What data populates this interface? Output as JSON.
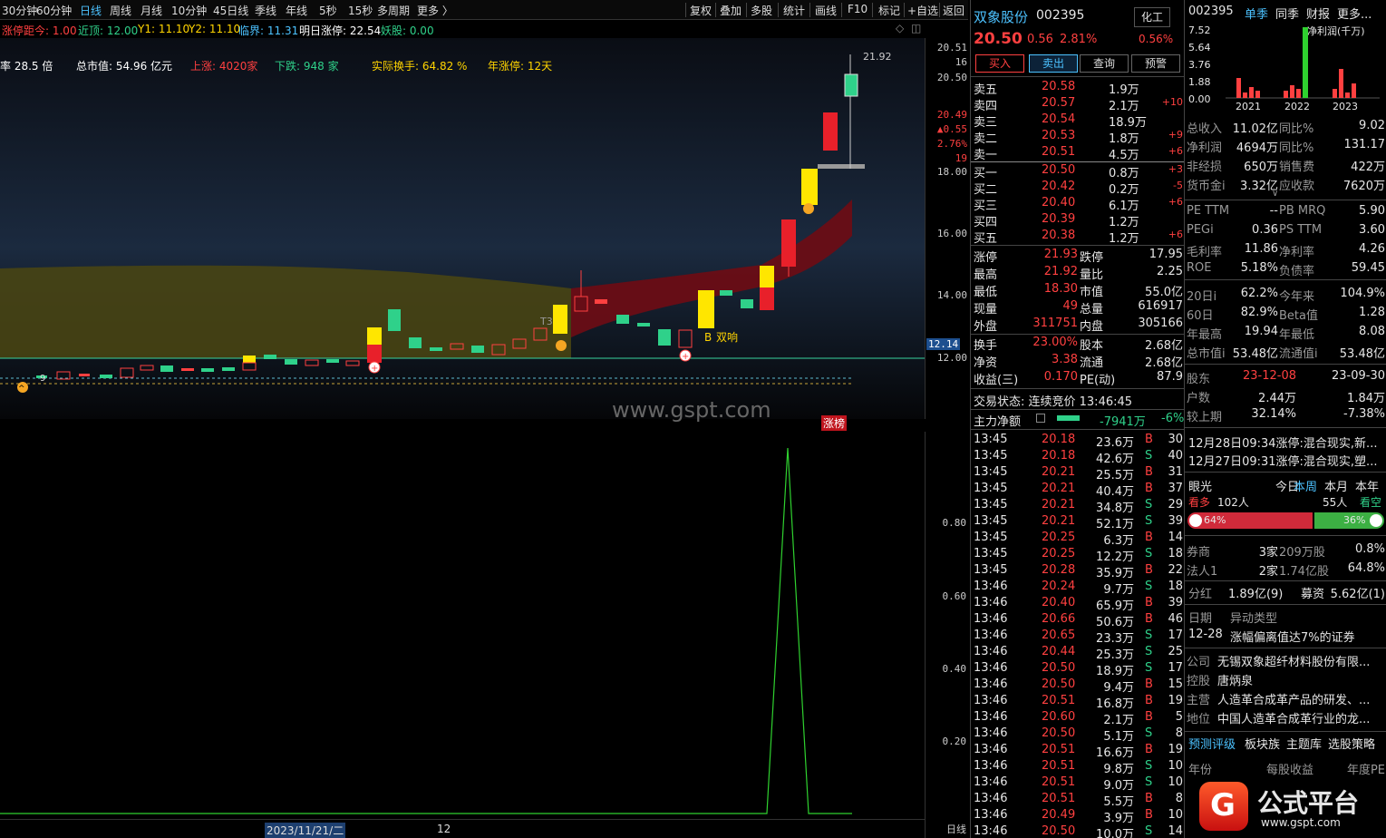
{
  "toolbar": {
    "items": [
      "30分钟",
      "60分钟",
      "日线",
      "周线",
      "月线",
      "10分钟",
      "45日线",
      "季线",
      "年线",
      "5秒",
      "15秒",
      "多周期",
      "更多 〉"
    ],
    "right": [
      "复权",
      "叠加",
      "多股",
      "统计",
      "画线",
      "F10",
      "标记",
      "+自选",
      "返回"
    ]
  },
  "info1": {
    "a": "涨停距今: 1.00",
    "b": "近顶: 12.00",
    "c": "Y1: 11.10",
    "d": "Y2: 11.10",
    "e": "临界: 11.31",
    "f": "明日涨停: 22.54",
    "g": "妖股: 0.00"
  },
  "info2": {
    "a": "率  28.5 倍",
    "b": "总市值: 54.96 亿元",
    "c": "上涨: 4020家",
    "d": "下跌: 948 家",
    "e": "实际换手: 64.82 %",
    "f": "年涨停: 12天"
  },
  "chart": {
    "yticks": [
      "20.51",
      "16",
      "20.50",
      "18.00",
      "16.00",
      "14.00",
      "12.00"
    ],
    "pct": [
      "20.49",
      "▲0.55",
      "2.76%",
      "19"
    ],
    "high_label": "21.92",
    "last_price_tag": "12.14",
    "tag_t3": "T3",
    "tag_shuangxiang": "双响",
    "tag_b": "B",
    "tag_9": "9",
    "watermark": "www.gspt.com",
    "zhangbang": "涨榜"
  },
  "lower": {
    "yticks": [
      "0.80",
      "0.60",
      "0.40",
      "0.20"
    ],
    "period": "日线"
  },
  "bottom": {
    "date": "2023/11/21/二",
    "month": "12"
  },
  "stock": {
    "name": "双象股份",
    "code": "002395",
    "sector": "化工",
    "price": "20.50",
    "change": "0.56",
    "pct": "2.81%",
    "extra": "0.56%",
    "buttons": [
      "买入",
      "卖出",
      "查询",
      "预警"
    ]
  },
  "asks": [
    {
      "label": "卖五",
      "price": "20.58",
      "vol": "1.9万",
      "chg": ""
    },
    {
      "label": "卖四",
      "price": "20.57",
      "vol": "2.1万",
      "chg": "+10"
    },
    {
      "label": "卖三",
      "price": "20.54",
      "vol": "18.9万",
      "chg": ""
    },
    {
      "label": "卖二",
      "price": "20.53",
      "vol": "1.8万",
      "chg": "+9"
    },
    {
      "label": "卖一",
      "price": "20.51",
      "vol": "4.5万",
      "chg": "+6"
    }
  ],
  "bids": [
    {
      "label": "买一",
      "price": "20.50",
      "vol": "0.8万",
      "chg": "+3"
    },
    {
      "label": "买二",
      "price": "20.42",
      "vol": "0.2万",
      "chg": "-5"
    },
    {
      "label": "买三",
      "price": "20.40",
      "vol": "6.1万",
      "chg": "+6"
    },
    {
      "label": "买四",
      "price": "20.39",
      "vol": "1.2万",
      "chg": ""
    },
    {
      "label": "买五",
      "price": "20.38",
      "vol": "1.2万",
      "chg": "+6"
    }
  ],
  "stats": [
    {
      "l1": "涨停",
      "v1": "21.93",
      "l2": "跌停",
      "v2": "17.95"
    },
    {
      "l1": "最高",
      "v1": "21.92",
      "l2": "量比",
      "v2": "2.25"
    },
    {
      "l1": "最低",
      "v1": "18.30",
      "l2": "市值",
      "v2": "55.0亿"
    },
    {
      "l1": "现量",
      "v1": "49",
      "l2": "总量",
      "v2": "616917"
    },
    {
      "l1": "外盘",
      "v1": "311751",
      "l2": "内盘",
      "v2": "305166"
    }
  ],
  "stats2": [
    {
      "l1": "换手",
      "v1": "23.00%",
      "l2": "股本",
      "v2": "2.68亿"
    },
    {
      "l1": "净资",
      "v1": "3.38",
      "l2": "流通",
      "v2": "2.68亿"
    },
    {
      "l1": "收益(三)",
      "v1": "0.170",
      "l2": "PE(动)",
      "v2": "87.9"
    }
  ],
  "trade_state": "交易状态: 连续竞价 13:46:45",
  "main_flow": {
    "label": "主力净额",
    "value": "-7941万",
    "pct": "-6%"
  },
  "ticks": [
    [
      "13:45",
      "20.18",
      "23.6万",
      "B",
      "30"
    ],
    [
      "13:45",
      "20.18",
      "42.6万",
      "S",
      "40"
    ],
    [
      "13:45",
      "20.21",
      "25.5万",
      "B",
      "31"
    ],
    [
      "13:45",
      "20.21",
      "40.4万",
      "B",
      "37"
    ],
    [
      "13:45",
      "20.21",
      "34.8万",
      "S",
      "29"
    ],
    [
      "13:45",
      "20.21",
      "52.1万",
      "S",
      "39"
    ],
    [
      "13:45",
      "20.25",
      "6.3万",
      "B",
      "14"
    ],
    [
      "13:45",
      "20.25",
      "12.2万",
      "S",
      "18"
    ],
    [
      "13:45",
      "20.28",
      "35.9万",
      "B",
      "22"
    ],
    [
      "13:46",
      "20.24",
      "9.7万",
      "S",
      "18"
    ],
    [
      "13:46",
      "20.40",
      "65.9万",
      "B",
      "39"
    ],
    [
      "13:46",
      "20.66",
      "50.6万",
      "B",
      "46"
    ],
    [
      "13:46",
      "20.65",
      "23.3万",
      "S",
      "17"
    ],
    [
      "13:46",
      "20.44",
      "25.3万",
      "S",
      "25"
    ],
    [
      "13:46",
      "20.50",
      "18.9万",
      "S",
      "17"
    ],
    [
      "13:46",
      "20.50",
      "9.4万",
      "B",
      "15"
    ],
    [
      "13:46",
      "20.51",
      "16.8万",
      "B",
      "19"
    ],
    [
      "13:46",
      "20.60",
      "2.1万",
      "B",
      "5"
    ],
    [
      "13:46",
      "20.50",
      "5.1万",
      "S",
      "8"
    ],
    [
      "13:46",
      "20.51",
      "16.6万",
      "B",
      "19"
    ],
    [
      "13:46",
      "20.51",
      "9.8万",
      "S",
      "10"
    ],
    [
      "13:46",
      "20.51",
      "9.0万",
      "S",
      "10"
    ],
    [
      "13:46",
      "20.51",
      "5.5万",
      "B",
      "8"
    ],
    [
      "13:46",
      "20.49",
      "3.9万",
      "B",
      "10"
    ],
    [
      "13:46",
      "20.50",
      "10.0万",
      "S",
      "14"
    ]
  ],
  "right": {
    "code": "002395",
    "tabs": [
      "单季",
      "同季",
      "财报",
      "更多..."
    ],
    "mini_y": [
      "7.52",
      "5.64",
      "3.76",
      "1.88",
      "0.00"
    ],
    "mini_title": "净利润(千万)",
    "mini_x": [
      "2021",
      "2022",
      "2023"
    ],
    "fin": [
      [
        "总收入",
        "11.02亿",
        "同比%",
        "9.02"
      ],
      [
        "净利润",
        "4694万",
        "同比%",
        "131.17"
      ],
      [
        "非经损",
        "650万",
        "销售费",
        "422万"
      ],
      [
        "货币金i",
        "3.32亿",
        "应收款",
        "7620万"
      ]
    ],
    "val": [
      [
        "PE TTM",
        "--",
        "PB MRQ",
        "5.90"
      ],
      [
        "PEGi",
        "0.36",
        "PS TTM",
        "3.60"
      ],
      [
        "毛利率",
        "11.86",
        "净利率",
        "4.26"
      ],
      [
        "ROE",
        "5.18%",
        "负债率",
        "59.45"
      ]
    ],
    "perf": [
      [
        "20日i",
        "62.2%",
        "今年来",
        "104.9%"
      ],
      [
        "60日",
        "82.9%",
        "Beta值",
        "1.28"
      ],
      [
        "年最高",
        "19.94",
        "年最低",
        "8.08"
      ],
      [
        "总市值i",
        "53.48亿",
        "流通值i",
        "53.48亿"
      ]
    ],
    "holders": [
      [
        "股东",
        "23-12-08",
        "23-09-30"
      ],
      [
        "户数",
        "2.44万",
        "1.84万"
      ],
      [
        "较上期",
        "32.14%",
        "-7.38%"
      ]
    ],
    "news": [
      "12月28日09:34涨停:混合现实,新...",
      "12月27日09:31涨停:混合现实,塑..."
    ],
    "vision": {
      "label": "眼光",
      "t1": "今日",
      "t2": "本周",
      "t3": "本月",
      "t4": "本年",
      "bull": "看多",
      "bull_n": "102人",
      "bear_n": "55人",
      "bear": "看空",
      "bull_pct": "64%",
      "bear_pct": "36%"
    },
    "inst": [
      [
        "券商",
        "3家",
        "209万股",
        "0.8%"
      ],
      [
        "法人1",
        "2家",
        "1.74亿股",
        "64.8%"
      ]
    ],
    "div": [
      "分红",
      "1.89亿(9)",
      "募资",
      "5.62亿(1)"
    ],
    "event_head": [
      "日期",
      "异动类型"
    ],
    "event": [
      "12-28",
      "涨幅偏离值达7%的证券"
    ],
    "company": [
      [
        "公司",
        "无锡双象超纤材料股份有限..."
      ],
      [
        "控股",
        "唐炳泉"
      ],
      [
        "主营",
        "人造革合成革产品的研发、..."
      ],
      [
        "地位",
        "中国人造革合成革行业的龙..."
      ]
    ],
    "bottom_tabs": [
      "预测评级",
      "板块族",
      "主题库",
      "选股策略"
    ],
    "forecast": [
      "年份",
      "每股收益",
      "年度PE"
    ],
    "logo_text": "公式平台",
    "logo_url": "www.gspt.com"
  },
  "colors": {
    "up": "#ff4040",
    "down": "#2fd18a",
    "accent": "#4cc2ff",
    "limit": "#ffe600"
  }
}
